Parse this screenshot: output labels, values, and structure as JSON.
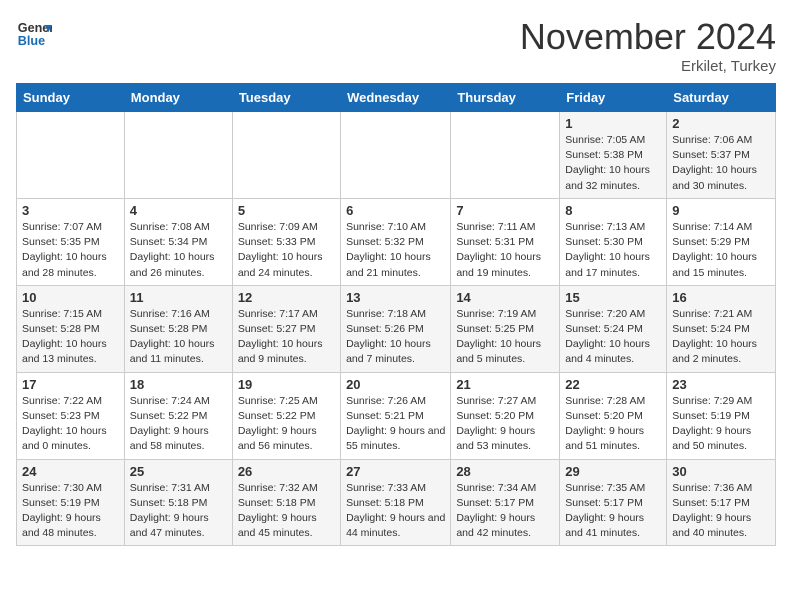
{
  "header": {
    "logo_line1": "General",
    "logo_line2": "Blue",
    "month": "November 2024",
    "location": "Erkilet, Turkey"
  },
  "weekdays": [
    "Sunday",
    "Monday",
    "Tuesday",
    "Wednesday",
    "Thursday",
    "Friday",
    "Saturday"
  ],
  "weeks": [
    [
      {
        "day": "",
        "info": ""
      },
      {
        "day": "",
        "info": ""
      },
      {
        "day": "",
        "info": ""
      },
      {
        "day": "",
        "info": ""
      },
      {
        "day": "",
        "info": ""
      },
      {
        "day": "1",
        "info": "Sunrise: 7:05 AM\nSunset: 5:38 PM\nDaylight: 10 hours and 32 minutes."
      },
      {
        "day": "2",
        "info": "Sunrise: 7:06 AM\nSunset: 5:37 PM\nDaylight: 10 hours and 30 minutes."
      }
    ],
    [
      {
        "day": "3",
        "info": "Sunrise: 7:07 AM\nSunset: 5:35 PM\nDaylight: 10 hours and 28 minutes."
      },
      {
        "day": "4",
        "info": "Sunrise: 7:08 AM\nSunset: 5:34 PM\nDaylight: 10 hours and 26 minutes."
      },
      {
        "day": "5",
        "info": "Sunrise: 7:09 AM\nSunset: 5:33 PM\nDaylight: 10 hours and 24 minutes."
      },
      {
        "day": "6",
        "info": "Sunrise: 7:10 AM\nSunset: 5:32 PM\nDaylight: 10 hours and 21 minutes."
      },
      {
        "day": "7",
        "info": "Sunrise: 7:11 AM\nSunset: 5:31 PM\nDaylight: 10 hours and 19 minutes."
      },
      {
        "day": "8",
        "info": "Sunrise: 7:13 AM\nSunset: 5:30 PM\nDaylight: 10 hours and 17 minutes."
      },
      {
        "day": "9",
        "info": "Sunrise: 7:14 AM\nSunset: 5:29 PM\nDaylight: 10 hours and 15 minutes."
      }
    ],
    [
      {
        "day": "10",
        "info": "Sunrise: 7:15 AM\nSunset: 5:28 PM\nDaylight: 10 hours and 13 minutes."
      },
      {
        "day": "11",
        "info": "Sunrise: 7:16 AM\nSunset: 5:28 PM\nDaylight: 10 hours and 11 minutes."
      },
      {
        "day": "12",
        "info": "Sunrise: 7:17 AM\nSunset: 5:27 PM\nDaylight: 10 hours and 9 minutes."
      },
      {
        "day": "13",
        "info": "Sunrise: 7:18 AM\nSunset: 5:26 PM\nDaylight: 10 hours and 7 minutes."
      },
      {
        "day": "14",
        "info": "Sunrise: 7:19 AM\nSunset: 5:25 PM\nDaylight: 10 hours and 5 minutes."
      },
      {
        "day": "15",
        "info": "Sunrise: 7:20 AM\nSunset: 5:24 PM\nDaylight: 10 hours and 4 minutes."
      },
      {
        "day": "16",
        "info": "Sunrise: 7:21 AM\nSunset: 5:24 PM\nDaylight: 10 hours and 2 minutes."
      }
    ],
    [
      {
        "day": "17",
        "info": "Sunrise: 7:22 AM\nSunset: 5:23 PM\nDaylight: 10 hours and 0 minutes."
      },
      {
        "day": "18",
        "info": "Sunrise: 7:24 AM\nSunset: 5:22 PM\nDaylight: 9 hours and 58 minutes."
      },
      {
        "day": "19",
        "info": "Sunrise: 7:25 AM\nSunset: 5:22 PM\nDaylight: 9 hours and 56 minutes."
      },
      {
        "day": "20",
        "info": "Sunrise: 7:26 AM\nSunset: 5:21 PM\nDaylight: 9 hours and 55 minutes."
      },
      {
        "day": "21",
        "info": "Sunrise: 7:27 AM\nSunset: 5:20 PM\nDaylight: 9 hours and 53 minutes."
      },
      {
        "day": "22",
        "info": "Sunrise: 7:28 AM\nSunset: 5:20 PM\nDaylight: 9 hours and 51 minutes."
      },
      {
        "day": "23",
        "info": "Sunrise: 7:29 AM\nSunset: 5:19 PM\nDaylight: 9 hours and 50 minutes."
      }
    ],
    [
      {
        "day": "24",
        "info": "Sunrise: 7:30 AM\nSunset: 5:19 PM\nDaylight: 9 hours and 48 minutes."
      },
      {
        "day": "25",
        "info": "Sunrise: 7:31 AM\nSunset: 5:18 PM\nDaylight: 9 hours and 47 minutes."
      },
      {
        "day": "26",
        "info": "Sunrise: 7:32 AM\nSunset: 5:18 PM\nDaylight: 9 hours and 45 minutes."
      },
      {
        "day": "27",
        "info": "Sunrise: 7:33 AM\nSunset: 5:18 PM\nDaylight: 9 hours and 44 minutes."
      },
      {
        "day": "28",
        "info": "Sunrise: 7:34 AM\nSunset: 5:17 PM\nDaylight: 9 hours and 42 minutes."
      },
      {
        "day": "29",
        "info": "Sunrise: 7:35 AM\nSunset: 5:17 PM\nDaylight: 9 hours and 41 minutes."
      },
      {
        "day": "30",
        "info": "Sunrise: 7:36 AM\nSunset: 5:17 PM\nDaylight: 9 hours and 40 minutes."
      }
    ]
  ]
}
